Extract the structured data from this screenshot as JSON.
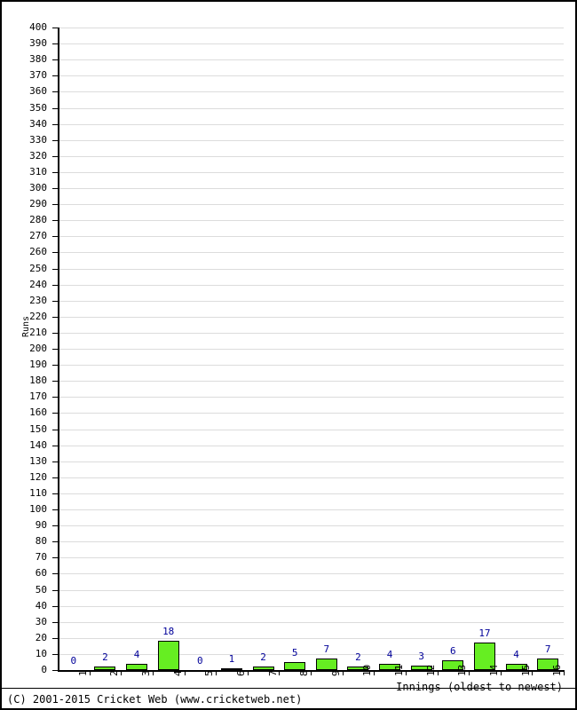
{
  "footer": {
    "copyright": "(C) 2001-2015 Cricket Web (www.cricketweb.net)"
  },
  "colors": {
    "bar_fill": "#66EE22",
    "bar_border": "#000000",
    "value_label": "#000099",
    "gridline": "#DCDCDC",
    "axis": "#000000",
    "background": "#FFFFFF"
  },
  "chart_data": {
    "type": "bar",
    "title": "",
    "xlabel": "Innings (oldest to newest)",
    "ylabel": "Runs",
    "categories": [
      "1",
      "2",
      "3",
      "4",
      "5",
      "6",
      "7",
      "8",
      "9",
      "10",
      "11",
      "12",
      "13",
      "14",
      "15",
      "16"
    ],
    "values": [
      0,
      2,
      4,
      18,
      0,
      1,
      2,
      5,
      7,
      2,
      4,
      3,
      6,
      17,
      4,
      7
    ],
    "value_labels": [
      "0",
      "2",
      "4",
      "18",
      "0",
      "1",
      "2",
      "5",
      "7",
      "2",
      "4",
      "3",
      "6",
      "17",
      "4",
      "7"
    ],
    "ylim": [
      0,
      400
    ],
    "ytick_step": 10,
    "yticks": [
      0,
      10,
      20,
      30,
      40,
      50,
      60,
      70,
      80,
      90,
      100,
      110,
      120,
      130,
      140,
      150,
      160,
      170,
      180,
      190,
      200,
      210,
      220,
      230,
      240,
      250,
      260,
      270,
      280,
      290,
      300,
      310,
      320,
      330,
      340,
      350,
      360,
      370,
      380,
      390,
      400
    ],
    "ytick_labels": [
      "0",
      "10",
      "20",
      "30",
      "40",
      "50",
      "60",
      "70",
      "80",
      "90",
      "100",
      "110",
      "120",
      "130",
      "140",
      "150",
      "160",
      "170",
      "180",
      "190",
      "200",
      "210",
      "220",
      "230",
      "240",
      "250",
      "260",
      "270",
      "280",
      "290",
      "300",
      "310",
      "320",
      "330",
      "340",
      "350",
      "360",
      "370",
      "380",
      "390",
      "400"
    ],
    "grid": true,
    "legend": false,
    "series": [
      {
        "name": "Runs",
        "values": [
          0,
          2,
          4,
          18,
          0,
          1,
          2,
          5,
          7,
          2,
          4,
          3,
          6,
          17,
          4,
          7
        ]
      }
    ]
  }
}
